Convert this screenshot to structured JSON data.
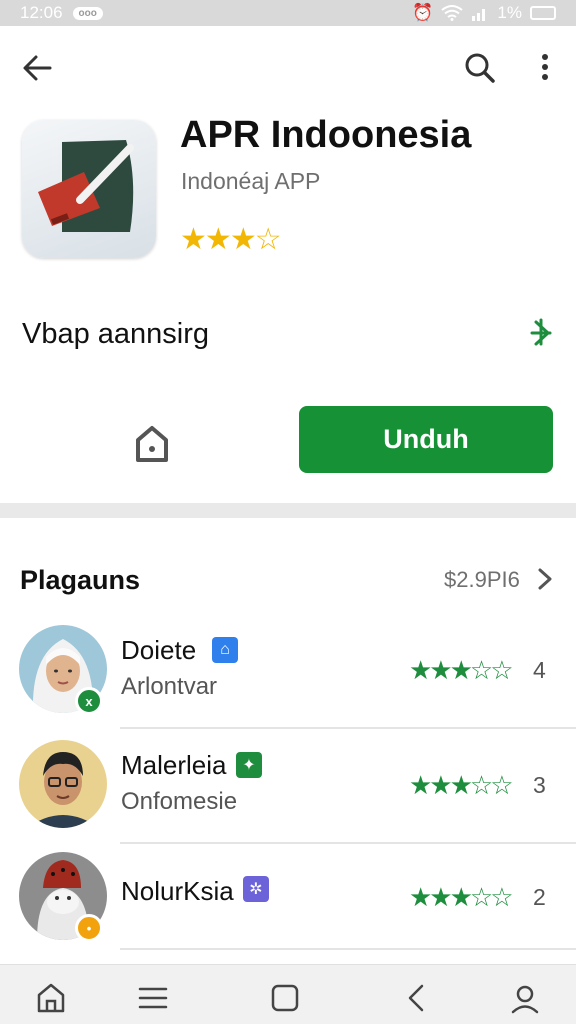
{
  "status": {
    "time": "12:06",
    "pill": "ooo",
    "battery_text": "1%"
  },
  "app": {
    "title": "APR Indoonesia",
    "subtitle": "Indonéaj APP",
    "rating_stars": 3,
    "rating_max": 5
  },
  "version_row": {
    "label": "Vbap aannsirg"
  },
  "actions": {
    "install_label": "Unduh"
  },
  "reviews_section": {
    "title": "Plagauns",
    "link": "$2.9PI6"
  },
  "reviews": [
    {
      "name": "Doiete",
      "subtitle": "Arlontvar",
      "stars": 3,
      "score": "4",
      "tag_color": "#2f80ed",
      "badge_color": "#1e8e3e",
      "badge_text": "x"
    },
    {
      "name": "Malerleia",
      "subtitle": "Onfomesie",
      "stars": 3,
      "score": "3",
      "tag_color": "#1e8e3e",
      "badge_color": "",
      "badge_text": ""
    },
    {
      "name": "NolurKsia",
      "subtitle": "",
      "stars": 3,
      "score": "2",
      "tag_color": "#6c63d9",
      "badge_color": "#f2a20d",
      "badge_text": "•"
    }
  ],
  "colors": {
    "accent": "#169135",
    "stars_green": "#1e8e3e",
    "stars_yellow": "#f2b705"
  },
  "icons": [
    "back-arrow-icon",
    "search-icon",
    "more-vert-icon",
    "download-icon",
    "home-icon",
    "chevron-right-icon",
    "menu-icon",
    "square-icon",
    "back-icon",
    "account-icon"
  ]
}
